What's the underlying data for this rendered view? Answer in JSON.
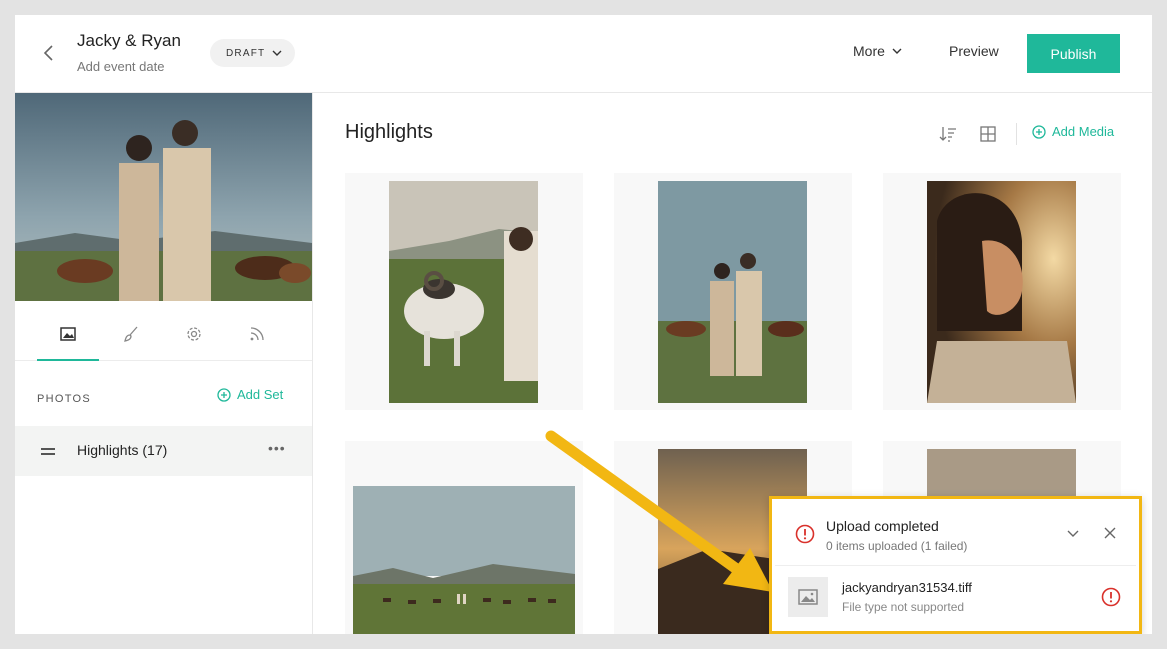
{
  "header": {
    "title": "Jacky & Ryan",
    "subtitle": "Add event date",
    "status": "DRAFT",
    "more_label": "More",
    "preview_label": "Preview",
    "publish_label": "Publish"
  },
  "sidebar": {
    "tabs": [
      "photos-tab",
      "design-tab",
      "settings-tab",
      "feed-tab"
    ],
    "section_label": "PHOTOS",
    "add_set_label": "Add Set",
    "sets": [
      {
        "name": "Highlights (17)"
      }
    ]
  },
  "main": {
    "title": "Highlights",
    "add_media_label": "Add Media"
  },
  "upload": {
    "title": "Upload completed",
    "summary": "0 items uploaded (1 failed)",
    "files": [
      {
        "name": "jackyandryan31534.tiff",
        "error": "File type not supported"
      }
    ]
  },
  "colors": {
    "accent": "#1fb89a",
    "error": "#d9312b",
    "highlight": "#f2b713"
  }
}
